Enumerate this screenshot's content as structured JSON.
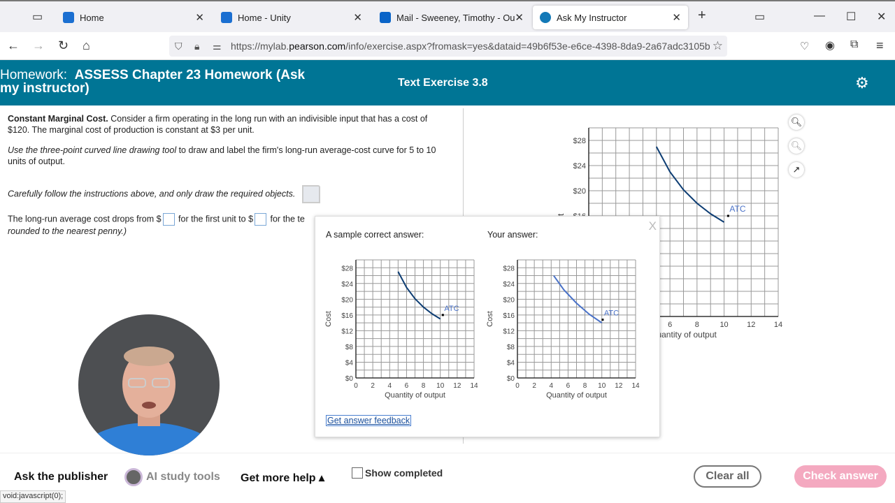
{
  "browser": {
    "tabs": [
      {
        "title": "Home",
        "icon": "unity-icon",
        "color": "#1b6fd1"
      },
      {
        "title": "Home - Unity",
        "icon": "unity-icon",
        "color": "#1b6fd1"
      },
      {
        "title": "Mail - Sweeney, Timothy - Outlo",
        "icon": "outlook-icon",
        "color": "#0a64c8"
      },
      {
        "title": "Ask My Instructor",
        "icon": "pearson-icon",
        "color": "#1379b7",
        "active": true
      }
    ],
    "url_prefix": "https://mylab.",
    "url_domain": "pearson.com",
    "url_rest": "/info/exercise.aspx?fromask=yes&dataid=49b6f53e-e6ce-4398-8da9-2a67adc3105b"
  },
  "header": {
    "homework_label": "Homework:",
    "homework_title": "ASSESS Chapter 23 Homework (Ask my instructor)",
    "exercise": "Text Exercise 3.8"
  },
  "question": {
    "title": "Constant Marginal Cost.",
    "intro": " Consider a firm operating in the long run with an indivisible input that has a cost of $120. The marginal cost of production is constant at $3 per unit.",
    "instr_italic": "Use the three-point curved line drawing tool",
    "instr_rest": " to draw and label the firm's long-run average-cost curve for 5 to 10 units of output.",
    "follow": "Carefully follow the instructions above, and only draw the required objects.",
    "fill_a": "The long-run average cost drops from $",
    "fill_b": " for the first unit to $",
    "fill_c": " for the te",
    "fill_d": "rounded to the nearest penny.)"
  },
  "popup": {
    "close": "X",
    "sample_label": "A sample correct answer:",
    "your_label": "Your answer:",
    "feedback_link": "Get answer feedback"
  },
  "chart_data": [
    {
      "id": "main",
      "type": "line",
      "xlabel": "Quantity of output",
      "ylabel": "Cost",
      "xlim": [
        0,
        14
      ],
      "ylim": [
        0,
        30
      ],
      "xticks": [
        0,
        2,
        4,
        6,
        8,
        10,
        12,
        14
      ],
      "yticks": [
        0,
        4,
        8,
        12,
        16,
        20,
        24,
        28
      ],
      "ytick_prefix": "$",
      "grid": true,
      "series": [
        {
          "name": "ATC",
          "color": "#0d3d73",
          "points": [
            [
              5,
              27
            ],
            [
              6,
              23
            ],
            [
              7,
              20.14
            ],
            [
              8,
              18
            ],
            [
              9,
              16.33
            ],
            [
              10,
              15
            ]
          ],
          "label_point": [
            10.3,
            16
          ]
        }
      ]
    },
    {
      "id": "sample",
      "type": "line",
      "xlabel": "Quantity of output",
      "ylabel": "Cost",
      "xlim": [
        0,
        14
      ],
      "ylim": [
        0,
        30
      ],
      "xticks": [
        0,
        2,
        4,
        6,
        8,
        10,
        12,
        14
      ],
      "yticks": [
        0,
        4,
        8,
        12,
        16,
        20,
        24,
        28
      ],
      "ytick_prefix": "$",
      "grid": true,
      "series": [
        {
          "name": "ATC",
          "color": "#0d3d73",
          "points": [
            [
              5,
              27
            ],
            [
              6,
              23
            ],
            [
              7,
              20.14
            ],
            [
              8,
              18
            ],
            [
              9,
              16.33
            ],
            [
              10,
              15
            ]
          ],
          "label_point": [
            10.3,
            16
          ]
        }
      ]
    },
    {
      "id": "yours",
      "type": "line",
      "xlabel": "Quantity of output",
      "ylabel": "Cost",
      "xlim": [
        0,
        14
      ],
      "ylim": [
        0,
        30
      ],
      "xticks": [
        0,
        2,
        4,
        6,
        8,
        10,
        12,
        14
      ],
      "yticks": [
        0,
        4,
        8,
        12,
        16,
        20,
        24,
        28
      ],
      "ytick_prefix": "$",
      "grid": true,
      "series": [
        {
          "name": "ATC",
          "color": "#4a72c8",
          "points": [
            [
              4.3,
              26
            ],
            [
              5.5,
              22.4
            ],
            [
              7,
              19
            ],
            [
              8.5,
              16.2
            ],
            [
              10,
              14
            ]
          ],
          "label_point": [
            10.1,
            14.8
          ]
        }
      ]
    }
  ],
  "footer": {
    "ask": "Ask the publisher",
    "ai": "AI study tools",
    "help": "Get more help ▴",
    "show_completed": "Show completed",
    "clear": "Clear all",
    "check": "Check answer"
  },
  "status_bar": "void:javascript(0);"
}
